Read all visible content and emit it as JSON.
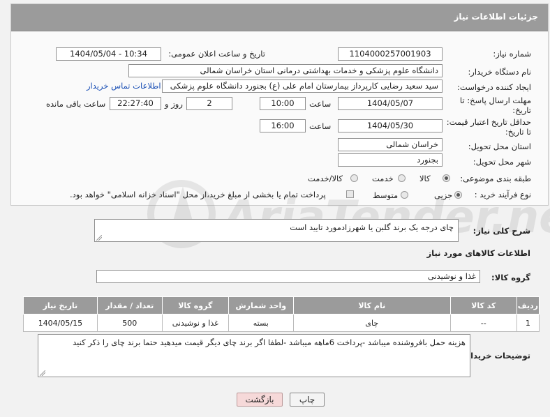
{
  "header": {
    "title": "جزئیات اطلاعات نیاز"
  },
  "form": {
    "need_number_label": "شماره نیاز:",
    "need_number": "1104000257001903",
    "announce_label": "تاریخ و ساعت اعلان عمومی:",
    "announce_value": "1404/05/04 - 10:34",
    "buyer_org_label": "نام دستگاه خریدار:",
    "buyer_org": "دانشگاه علوم پزشکی و خدمات بهداشتی درمانی استان خراسان شمالی",
    "creator_label": "ایجاد کننده درخواست:",
    "creator": "سید سعید رضایی کارپرداز بیمارستان امام علی (ع) بجنورد دانشگاه علوم پزشکی",
    "contact_link": "اطلاعات تماس خریدار",
    "deadline_label": "مهلت ارسال پاسخ: تا تاریخ:",
    "deadline_date": "1404/05/07",
    "deadline_time_label": "ساعت",
    "deadline_time": "10:00",
    "days_value": "2",
    "days_label": "روز و",
    "remaining_time": "22:27:40",
    "remaining_label": "ساعت باقی مانده",
    "validity_label": "حداقل تاریخ اعتبار قیمت: تا تاریخ:",
    "validity_date": "1404/05/30",
    "validity_time_label": "ساعت",
    "validity_time": "16:00",
    "province_label": "استان محل تحویل:",
    "province": "خراسان شمالی",
    "city_label": "شهر محل تحویل:",
    "city": "بجنورد",
    "category_label": "طبقه بندی موضوعی:",
    "category_options": [
      "کالا",
      "خدمت",
      "کالا/خدمت"
    ],
    "category_selected": "کالا",
    "process_label": "نوع فرآیند خرید :",
    "process_options": [
      "جزیی",
      "متوسط"
    ],
    "process_selected": "جزیی",
    "treasury_note": "پرداخت تمام یا بخشی از مبلغ خرید،از محل \"اسناد خزانه اسلامی\" خواهد بود."
  },
  "description": {
    "label": "شرح کلی نیاز:",
    "text": "چای درجه یک برند گلبن یا شهرزادمورد تایید است"
  },
  "goods": {
    "section_title": "اطلاعات کالاهای مورد نیاز",
    "group_label": "گروه کالا:",
    "group_value": "غذا و نوشیدنی",
    "columns": [
      "ردیف",
      "کد کالا",
      "نام کالا",
      "واحد شمارش",
      "گروه کالا",
      "تعداد / مقدار",
      "تاریخ نیاز"
    ],
    "rows": [
      [
        "1",
        "--",
        "چای",
        "بسته",
        "غذا و نوشیدنی",
        "500",
        "1404/05/15"
      ]
    ]
  },
  "buyer_notes": {
    "label": "توضیحات خریدار:",
    "text": "هزینه حمل بافروشنده میباشد -پرداخت 6ماهه میباشد -لطفا اگر برند چای دیگر قیمت میدهید حتما برند چای را ذکر کنید"
  },
  "actions": {
    "print_label": "چاپ",
    "back_label": "بازگشت"
  },
  "watermark": {
    "text": "AriaTender.net"
  },
  "colors": {
    "header_bg": "#9b9b9b",
    "link": "#1a4fb5",
    "back_button_bg": "#f6d9d9"
  }
}
